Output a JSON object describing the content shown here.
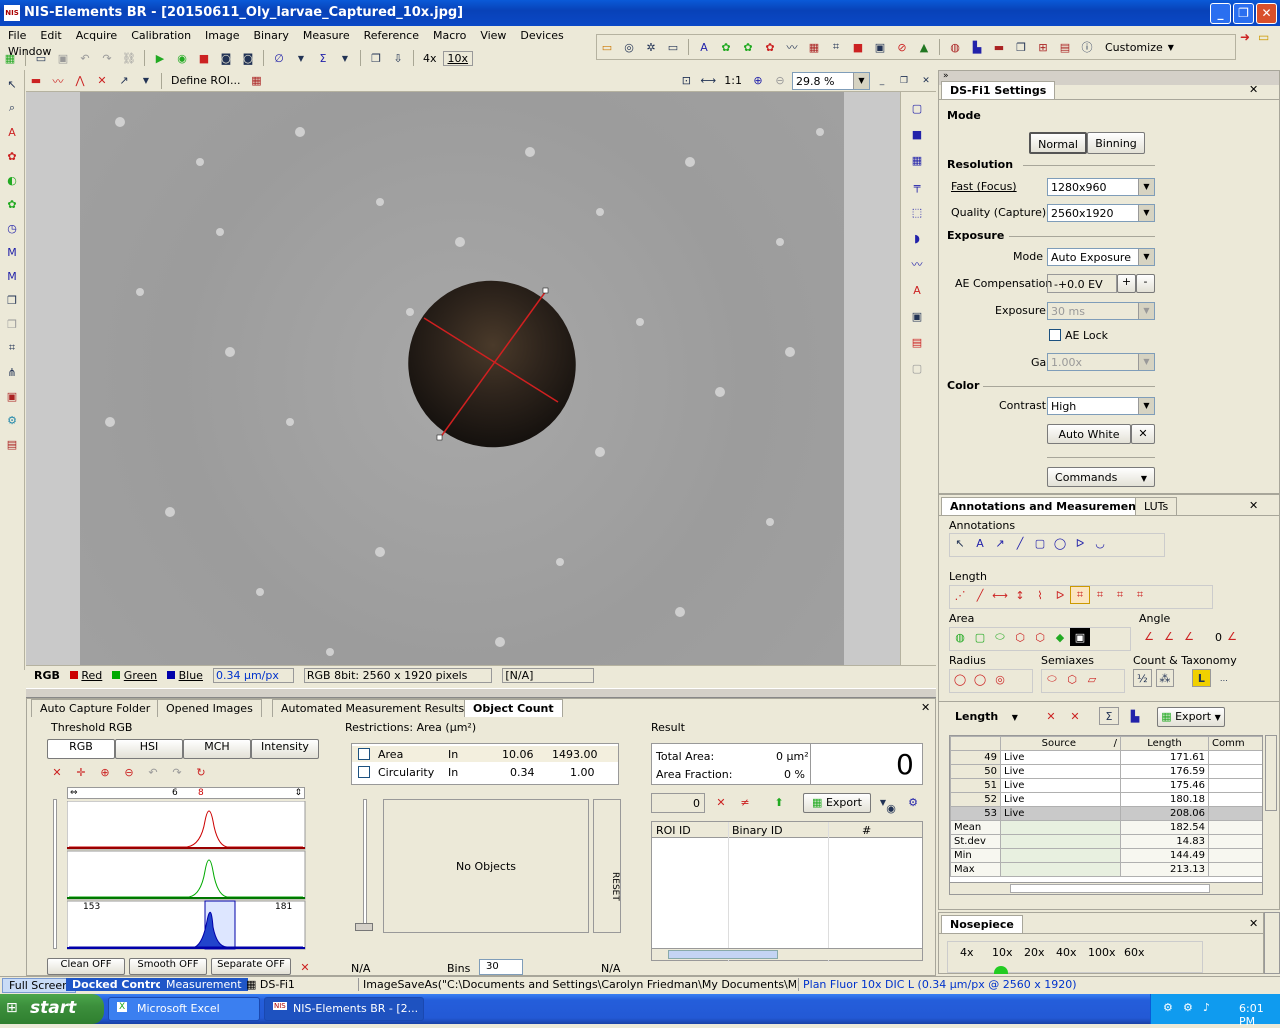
{
  "window": {
    "title": "NIS-Elements BR  - [20150611_Oly_larvae_Captured_10x.jpg]",
    "app_icon": "NIS"
  },
  "menu": [
    "File",
    "Edit",
    "Acquire",
    "Calibration",
    "Image",
    "Binary",
    "Measure",
    "Reference",
    "Macro",
    "View",
    "Devices",
    "Window"
  ],
  "toolbar": {
    "zoom_4x": "4x",
    "zoom_10x": "10x",
    "customize": "Customize"
  },
  "image_toolbar": {
    "define_roi": "Define ROI...",
    "ratio": "1:1",
    "zoom_value": "29.8 %"
  },
  "channels": {
    "rgb": "RGB",
    "red": "Red",
    "green": "Green",
    "blue": "Blue",
    "calibration": "0.34 µm/px",
    "info": "RGB 8bit: 2560 x 1920 pixels",
    "na": "[N/A]"
  },
  "dsfi1": {
    "title": "DS-Fi1 Settings",
    "mode_label": "Mode",
    "normal": "Normal",
    "binning": "Binning",
    "resolution_label": "Resolution",
    "fast_label": "Fast (Focus)",
    "fast_value": "1280x960",
    "quality_label": "Quality (Capture)",
    "quality_value": "2560x1920",
    "exposure_label": "Exposure",
    "mode2_label": "Mode",
    "mode2_value": "Auto Exposure",
    "ae_comp_label": "AE Compensation",
    "ae_comp_value": "-+0.0 EV",
    "plus": "+",
    "minus": "-",
    "exposure2_label": "Exposure",
    "exposure2_value": "30 ms",
    "ae_lock": "AE Lock",
    "gain_label": "Gain",
    "gain_value": "1.00x",
    "color_label": "Color",
    "contrast_label": "Contrast",
    "contrast_value": "High",
    "auto_white": "Auto White",
    "commands": "Commands"
  },
  "annot": {
    "tab1": "Annotations and Measurements",
    "tab2": "LUTs",
    "annotations": "Annotations",
    "length": "Length",
    "area": "Area",
    "angle": "Angle",
    "angle_value": "0",
    "radius": "Radius",
    "semiaxes": "Semiaxes",
    "count_tax": "Count & Taxonomy",
    "length_dd": "Length",
    "export": "Export",
    "cols": [
      "Source",
      "Length",
      "Comm"
    ],
    "rows": [
      {
        "id": "49",
        "source": "Live",
        "len": "171.61"
      },
      {
        "id": "50",
        "source": "Live",
        "len": "176.59"
      },
      {
        "id": "51",
        "source": "Live",
        "len": "175.46"
      },
      {
        "id": "52",
        "source": "Live",
        "len": "180.18"
      },
      {
        "id": "53",
        "source": "Live",
        "len": "208.06"
      }
    ],
    "stats": [
      {
        "name": "Mean",
        "val": "182.54"
      },
      {
        "name": "St.dev",
        "val": "14.83"
      },
      {
        "name": "Min",
        "val": "144.49"
      },
      {
        "name": "Max",
        "val": "213.13"
      }
    ]
  },
  "nosepiece": {
    "title": "Nosepiece",
    "mags": [
      "4x",
      "10x",
      "20x",
      "40x",
      "100x",
      "60x"
    ]
  },
  "bottom_tabs": [
    "Auto Capture Folder",
    "Opened Images",
    "Automated Measurement Results",
    "Object Count"
  ],
  "threshold": {
    "title": "Threshold  RGB",
    "modes": [
      "RGB",
      "HSI",
      "MCH",
      "Intensity"
    ],
    "slider_lo": "6",
    "slider_hi": "8",
    "blue_lo": "153",
    "blue_hi": "181",
    "clean": "Clean  OFF",
    "smooth": "Smooth  OFF",
    "separate": "Separate  OFF"
  },
  "restrictions": {
    "title": "Restrictions:  Area  (µm²)",
    "rows": [
      {
        "name": "Area",
        "op": "In",
        "lo": "10.06",
        "hi": "1493.00"
      },
      {
        "name": "Circularity",
        "op": "In",
        "lo": "0.34",
        "hi": "1.00"
      }
    ],
    "no_objects": "No Objects",
    "reset": "RESET",
    "na_left": "N/A",
    "bins_label": "Bins",
    "bins": "30",
    "na_right": "N/A"
  },
  "result": {
    "title": "Result",
    "total_area_label": "Total Area:",
    "total_area": "0 µm²",
    "fraction_label": "Area Fraction:",
    "fraction": "0 %",
    "count": "0",
    "counter": "0",
    "export": "Export",
    "cols": [
      "ROI ID",
      "Binary ID",
      "#"
    ]
  },
  "statusbar": {
    "full_screen": "Full Screen",
    "docked": "Docked Controls",
    "measurement": "Measurement",
    "dsfi1": "DS-Fi1",
    "macro": "ImageSaveAs(\"C:\\Documents and Settings\\Carolyn Friedman\\My Documents\\My Dropbox\\",
    "objective": "Plan Fluor 10x DIC L (0.34 µm/px @ 2560 x 1920)"
  },
  "taskbar": {
    "start": "start",
    "excel": "Microsoft Excel",
    "nis": "NIS-Elements BR  - [2...",
    "clock": "6:01 PM"
  }
}
